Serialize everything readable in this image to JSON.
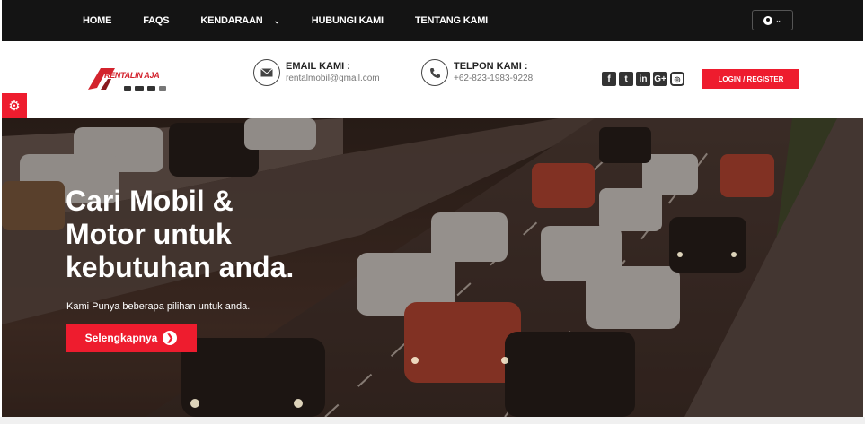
{
  "nav": {
    "items": [
      {
        "label": "HOME"
      },
      {
        "label": "FAQS"
      },
      {
        "label": "KENDARAAN",
        "has_dropdown": true
      },
      {
        "label": "HUBUNGI KAMI"
      },
      {
        "label": "TENTANG KAMI"
      }
    ],
    "user_menu_icon": "user-circle-icon"
  },
  "header": {
    "logo_text": "RENTALIN AJA",
    "email_title": "EMAIL KAMI :",
    "email_value": "rentalmobil@gmail.com",
    "phone_title": "TELPON KAMI :",
    "phone_value": "+62-823-1983-9228",
    "socials": [
      "facebook-icon",
      "twitter-icon",
      "linkedin-icon",
      "google-plus-icon",
      "instagram-icon"
    ],
    "login_label": "LOGIN / REGISTER"
  },
  "hero": {
    "title_line1": "Cari Mobil &",
    "title_line2": "Motor untuk",
    "title_line3": "kebutuhan anda.",
    "subtitle": "Kami Punya beberapa pilihan untuk anda.",
    "cta_label": "Selengkapnya"
  },
  "colors": {
    "accent": "#ee1c2e",
    "nav_bg": "#141414"
  }
}
